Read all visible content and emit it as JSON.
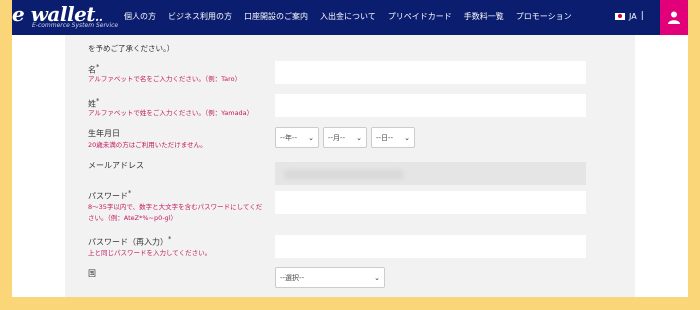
{
  "header": {
    "logo": "wallet",
    "logo_prefix": "e",
    "logo_tagline": "E-commerce System Service",
    "nav": [
      "個人の方",
      "ビジネス利用の方",
      "口座開設のご案内",
      "入出金について",
      "プリペイドカード",
      "手数料一覧",
      "プロモーション"
    ],
    "language": "JA",
    "separator": "|",
    "brand_color": "#0b1d6e",
    "user_button_color": "#e2007a"
  },
  "form": {
    "intro": "を予めご了承ください。）",
    "first_name": {
      "label": "名",
      "required_mark": "*",
      "hint": "アルファベットで名をご入力ください。（例：Taro）",
      "value": ""
    },
    "last_name": {
      "label": "姓",
      "required_mark": "*",
      "hint": "アルファベットで姓をご入力ください。（例：Yamada）",
      "value": ""
    },
    "birthday": {
      "label": "生年月日",
      "hint": "20歳未満の方はご利用いただけません。",
      "year": "--年--",
      "month": "--月--",
      "day": "--日--"
    },
    "email": {
      "label": "メールアドレス"
    },
    "password": {
      "label": "パスワード",
      "required_mark": "*",
      "hint_line1": "8〜35字以内で、数字と大文字を含むパスワードにしてくだ",
      "hint_line2": "さい。（例：AteZ*%~p0-gl）",
      "value": ""
    },
    "password_confirm": {
      "label": "パスワード（再入力）",
      "required_mark": "*",
      "hint": "上と同じパスワードを入力してください。",
      "value": ""
    },
    "country": {
      "label": "国",
      "selected": "--選択--"
    }
  }
}
